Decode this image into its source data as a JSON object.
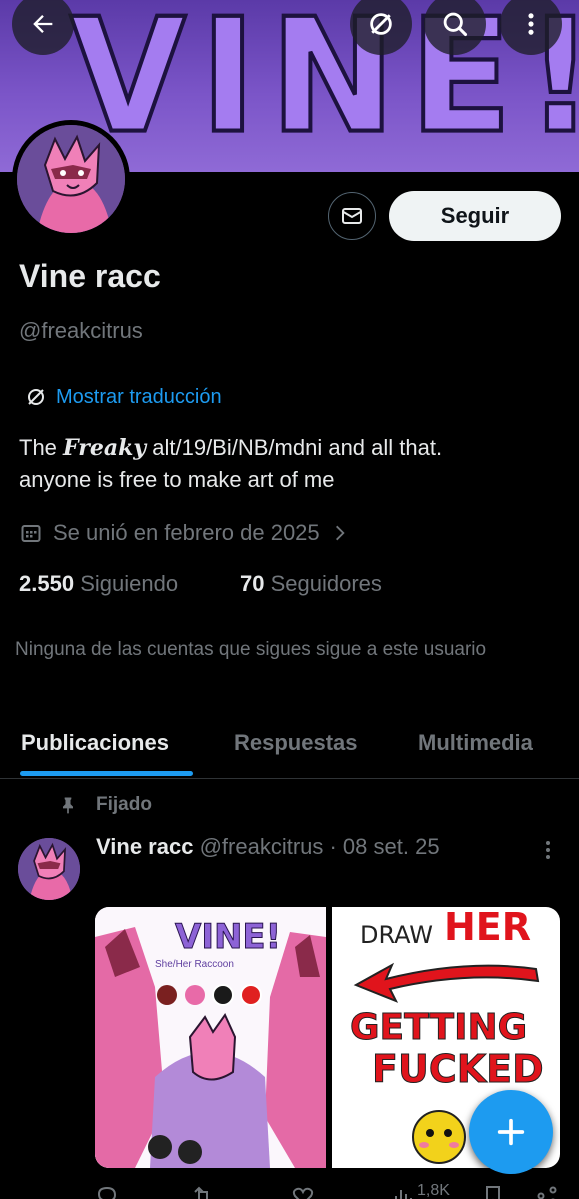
{
  "header": {
    "banner_text": "VINE!",
    "back_icon": "arrow-left-icon",
    "translate_icon": "translate-icon",
    "search_icon": "search-icon",
    "more_icon": "more-vertical-icon"
  },
  "profile": {
    "name": "Vine racc",
    "handle": "@freakcitrus",
    "follow_label": "Seguir",
    "translate_label": "Mostrar traducción",
    "bio_prefix": "The ",
    "bio_freaky": "Freaky",
    "bio_rest": " alt/19/Bi/NB/mdni and all that.",
    "bio_line2": "anyone is free to make art of me",
    "joined": "Se unió en febrero de 2025",
    "following_count": "2.550",
    "following_label": "Siguiendo",
    "followers_count": "70",
    "followers_label": "Seguidores",
    "mutuals_note": "Ninguna de las cuentas que sigues sigue a este usuario"
  },
  "tabs": [
    {
      "label": "Publicaciones",
      "active": true
    },
    {
      "label": "Respuestas",
      "active": false
    },
    {
      "label": "Multimedia",
      "active": false
    }
  ],
  "post": {
    "pinned_label": "Fijado",
    "name": "Vine racc",
    "handle_date": "@freakcitrus · 08 set. 25",
    "image1_title": "VINE!",
    "image1_caption": "She/Her  Raccoon",
    "image2_line1": "DRAW",
    "image2_line2": "HER",
    "image2_line3": "GETTING",
    "image2_line4": "FUCKED",
    "views": "1,8K"
  },
  "colors": {
    "accent": "#1d9bf0",
    "muted": "#71767b",
    "banner": "#7b55c8"
  }
}
